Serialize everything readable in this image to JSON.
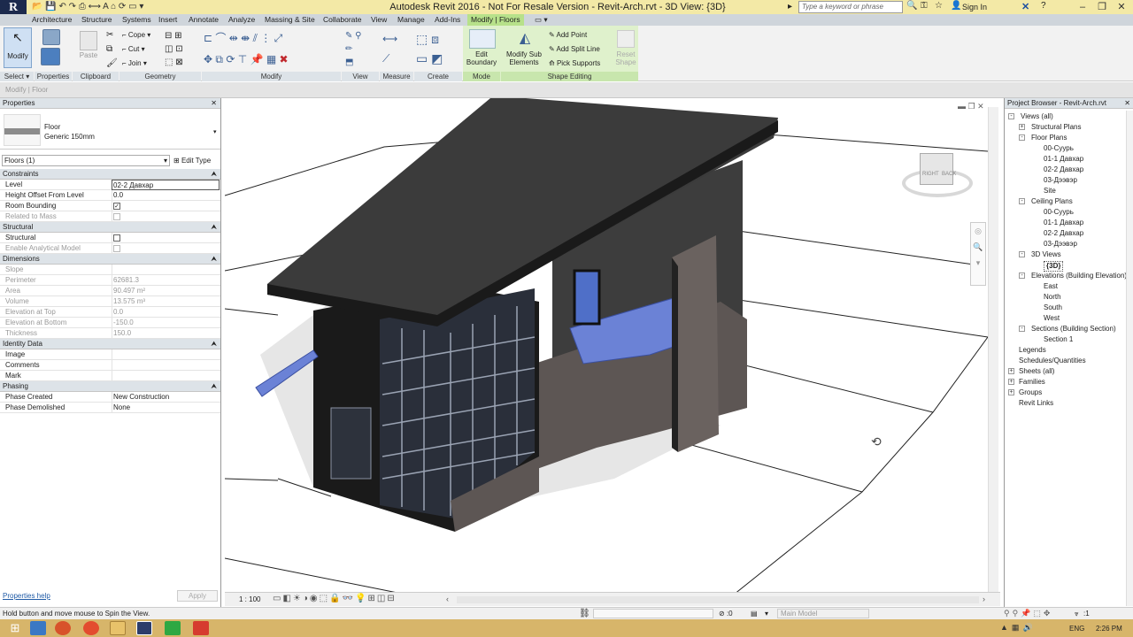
{
  "app": {
    "logo": "R",
    "title": "Autodesk Revit 2016 -  Not For Resale Version -     Revit-Arch.rvt - 3D View: {3D}",
    "search_placeholder": "Type a keyword or phrase",
    "sign_in": "Sign In"
  },
  "tabs": [
    "Architecture",
    "Structure",
    "Systems",
    "Insert",
    "Annotate",
    "Analyze",
    "Massing & Site",
    "Collaborate",
    "View",
    "Manage",
    "Add-Ins",
    "Modify | Floors"
  ],
  "ribbon": {
    "modify_label": "Modify",
    "select_label": "Select",
    "properties_label": "Properties",
    "paste_label": "Paste",
    "cope_label": "Cope",
    "cut_label": "Cut",
    "join_label": "Join",
    "panels": [
      "Clipboard",
      "Geometry",
      "Modify",
      "View",
      "Measure",
      "Create",
      "Mode",
      "Shape Editing"
    ],
    "edit_boundary": "Edit Boundary",
    "modify_sub_elements": "Modify Sub Elements",
    "add_point": "Add Point",
    "add_split_line": "Add Split Line",
    "pick_supports": "Pick Supports",
    "reset_shape": "Reset Shape"
  },
  "modebar": "Modify | Floor",
  "properties": {
    "title": "Properties",
    "type_family": "Floor",
    "type_name": "Generic 150mm",
    "selector": "Floors (1)",
    "edit_type": "Edit Type",
    "sections": {
      "constraints": "Constraints",
      "structural": "Structural",
      "dimensions": "Dimensions",
      "identity": "Identity Data",
      "phasing": "Phasing"
    },
    "constraints": [
      {
        "k": "Level",
        "v": "02-2 Давхар"
      },
      {
        "k": "Height Offset From Level",
        "v": "0.0"
      },
      {
        "k": "Room Bounding",
        "v": "✓"
      },
      {
        "k": "Related to Mass",
        "v": ""
      }
    ],
    "structural": [
      {
        "k": "Structural",
        "v": ""
      },
      {
        "k": "Enable Analytical Model",
        "v": ""
      }
    ],
    "dimensions": [
      {
        "k": "Slope",
        "v": ""
      },
      {
        "k": "Perimeter",
        "v": "62681.3"
      },
      {
        "k": "Area",
        "v": "90.497 m²"
      },
      {
        "k": "Volume",
        "v": "13.575 m³"
      },
      {
        "k": "Elevation at Top",
        "v": "0.0"
      },
      {
        "k": "Elevation at Bottom",
        "v": "-150.0"
      },
      {
        "k": "Thickness",
        "v": "150.0"
      }
    ],
    "identity": [
      {
        "k": "Image",
        "v": ""
      },
      {
        "k": "Comments",
        "v": ""
      },
      {
        "k": "Mark",
        "v": ""
      }
    ],
    "phasing": [
      {
        "k": "Phase Created",
        "v": "New Construction"
      },
      {
        "k": "Phase Demolished",
        "v": "None"
      }
    ],
    "help": "Properties help",
    "apply": "Apply"
  },
  "viewcube": {
    "right": "RIGHT",
    "back": "BACK"
  },
  "browser": {
    "title": "Project Browser - Revit-Arch.rvt",
    "nodes": [
      {
        "t": "Views (all)",
        "lvl": 0,
        "tog": "-"
      },
      {
        "t": "Structural Plans",
        "lvl": 1,
        "tog": "+"
      },
      {
        "t": "Floor Plans",
        "lvl": 1,
        "tog": "-"
      },
      {
        "t": "00-Суурь",
        "lvl": 2
      },
      {
        "t": "01-1 Давхар",
        "lvl": 2
      },
      {
        "t": "02-2 Давхар",
        "lvl": 2
      },
      {
        "t": "03-Дээвэр",
        "lvl": 2
      },
      {
        "t": "Site",
        "lvl": 2
      },
      {
        "t": "Ceiling Plans",
        "lvl": 1,
        "tog": "-"
      },
      {
        "t": "00-Суурь",
        "lvl": 2
      },
      {
        "t": "01-1 Давхар",
        "lvl": 2
      },
      {
        "t": "02-2 Давхар",
        "lvl": 2
      },
      {
        "t": "03-Дээвэр",
        "lvl": 2
      },
      {
        "t": "3D Views",
        "lvl": 1,
        "tog": "-"
      },
      {
        "t": "{3D}",
        "lvl": 2,
        "bold": true
      },
      {
        "t": "Elevations (Building Elevation)",
        "lvl": 1,
        "tog": "-"
      },
      {
        "t": "East",
        "lvl": 2
      },
      {
        "t": "North",
        "lvl": 2
      },
      {
        "t": "South",
        "lvl": 2
      },
      {
        "t": "West",
        "lvl": 2
      },
      {
        "t": "Sections (Building Section)",
        "lvl": 1,
        "tog": "-"
      },
      {
        "t": "Section 1",
        "lvl": 2
      },
      {
        "t": "Legends",
        "lvl": 0,
        "icon": true
      },
      {
        "t": "Schedules/Quantities",
        "lvl": 0,
        "icon": true
      },
      {
        "t": "Sheets (all)",
        "lvl": 0,
        "tog": "+",
        "icon": true
      },
      {
        "t": "Families",
        "lvl": 0,
        "tog": "+",
        "icon": true
      },
      {
        "t": "Groups",
        "lvl": 0,
        "tog": "+",
        "icon": true
      },
      {
        "t": "Revit Links",
        "lvl": 0,
        "icon": true
      }
    ]
  },
  "viewcontrol": {
    "scale": "1 : 100"
  },
  "status": {
    "message": "Hold button and move mouse to Spin the View.",
    "count": ":0",
    "model": "Main Model",
    "filter_count": ":1"
  },
  "taskbar": {
    "lang": "ENG",
    "time": "2:26 PM"
  },
  "colors": {
    "tab_active": "#b7e18a",
    "title_bg": "#f3e9a6",
    "taskbar": "#d7b56a",
    "floor_selected": "#6b82d6"
  }
}
